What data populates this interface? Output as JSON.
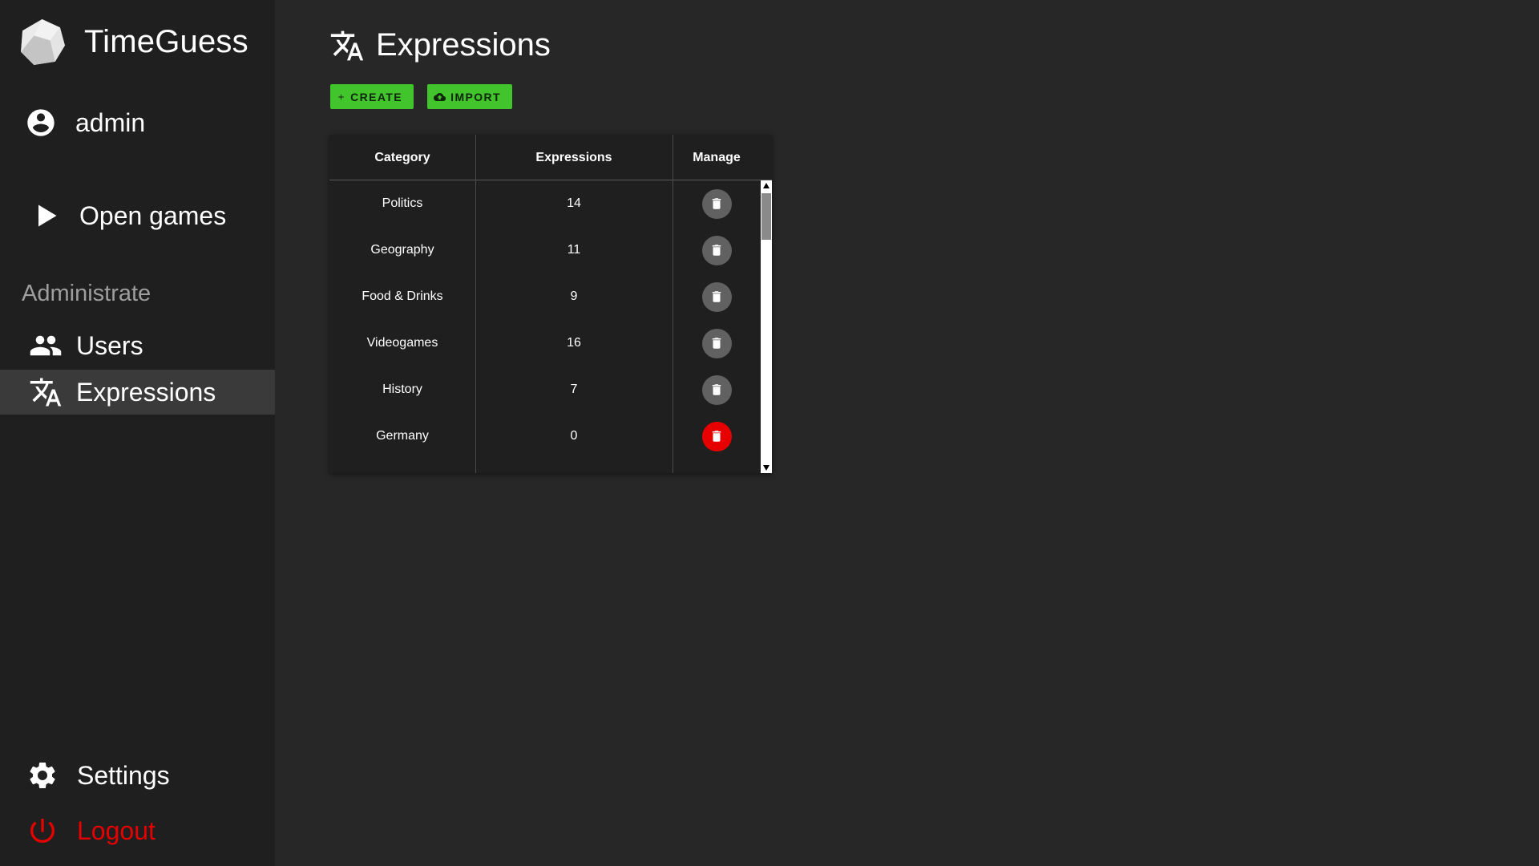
{
  "app": {
    "name": "TimeGuess"
  },
  "sidebar": {
    "user": {
      "label": "admin",
      "icon": "account-circle-icon"
    },
    "open_games": {
      "label": "Open games",
      "icon": "play-icon"
    },
    "section_header": "Administrate",
    "users": {
      "label": "Users",
      "icon": "people-icon"
    },
    "expressions": {
      "label": "Expressions",
      "icon": "translate-icon"
    },
    "settings": {
      "label": "Settings",
      "icon": "gear-icon"
    },
    "logout": {
      "label": "Logout",
      "icon": "power-icon"
    }
  },
  "page": {
    "title": "Expressions",
    "icon": "translate-icon"
  },
  "toolbar": {
    "create_label": "CREATE",
    "import_label": "IMPORT"
  },
  "table": {
    "headers": {
      "category": "Category",
      "expressions": "Expressions",
      "manage": "Manage"
    },
    "rows": [
      {
        "category": "Politics",
        "expressions": "14",
        "delete_style": "default"
      },
      {
        "category": "Geography",
        "expressions": "11",
        "delete_style": "default"
      },
      {
        "category": "Food & Drinks",
        "expressions": "9",
        "delete_style": "default"
      },
      {
        "category": "Videogames",
        "expressions": "16",
        "delete_style": "default"
      },
      {
        "category": "History",
        "expressions": "7",
        "delete_style": "default"
      },
      {
        "category": "Germany",
        "expressions": "0",
        "delete_style": "danger"
      }
    ]
  },
  "colors": {
    "background": "#272727",
    "sidebar": "#1f1f1f",
    "accent_green": "#42c42c",
    "danger_red": "#e60000",
    "delete_grey": "#616161"
  }
}
